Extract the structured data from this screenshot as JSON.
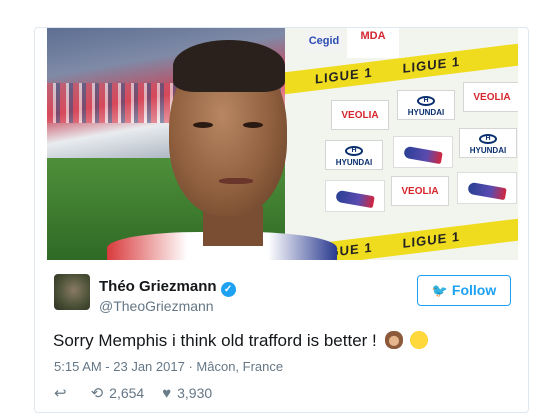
{
  "media": {
    "board_texts": {
      "ligue": "LIGUE 1",
      "sponsor_hyundai": "HYUNDAI",
      "sponsor_veolia": "VEOLIA",
      "sponsor_top_left": "Cegid",
      "sponsor_mda": "MDA"
    }
  },
  "tweet": {
    "author_name": "Théo Griezmann",
    "verified_icon": "verified-check-icon",
    "handle": "@TheoGriezmann",
    "follow_label": "Follow",
    "follow_icon": "twitter-bird-icon",
    "text": "Sorry Memphis i think old trafford is better !",
    "emojis": [
      "see-no-evil-monkey-icon",
      "face-with-rolling-eyes-icon"
    ],
    "timestamp": "5:15 AM - 23 Jan 2017",
    "separator": "·",
    "location": "Mâcon, France",
    "retweets": "2,654",
    "likes": "3,930",
    "colors": {
      "accent": "#1da1f2",
      "secondary_text": "#657786",
      "primary_text": "#14171a"
    }
  }
}
